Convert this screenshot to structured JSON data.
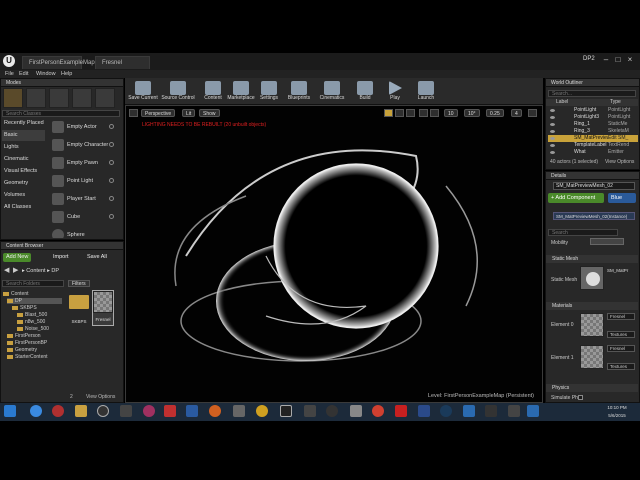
{
  "window": {
    "tabs": [
      "FirstPersonExampleMap",
      "Fresnel"
    ],
    "project": "DP2"
  },
  "menu": [
    "File",
    "Edit",
    "Window",
    "Help"
  ],
  "modes": {
    "title": "Modes",
    "search_placeholder": "Search Classes",
    "categories": [
      "Recently Placed",
      "Basic",
      "Lights",
      "Cinematic",
      "Visual Effects",
      "Geometry",
      "Volumes",
      "All Classes"
    ],
    "selected_category": "Basic",
    "items": [
      "Empty Actor",
      "Empty Character",
      "Empty Pawn",
      "Point Light",
      "Player Start",
      "Cube",
      "Sphere"
    ]
  },
  "toolbar": [
    "Save Current",
    "Source Control",
    "Content",
    "Marketplace",
    "Settings",
    "Blueprints",
    "Cinematics",
    "Build",
    "Play",
    "Launch"
  ],
  "viewport": {
    "perspective": "Perspective",
    "lit": "Lit",
    "show": "Show",
    "grid": "10",
    "angle": "10°",
    "scale": "0.25",
    "cam": "4",
    "warning": "LIGHTING NEEDS TO BE REBUILT (20 unbuilt objects)",
    "level_label": "Level:",
    "level_name": "FirstPersonExampleMap (Persistent)"
  },
  "content_browser": {
    "title": "Content Browser",
    "add_new": "Add New",
    "import": "Import",
    "save_all": "Save All",
    "path": [
      "Content",
      "DP"
    ],
    "search_placeholder": "Search Folders",
    "filters": "Filters",
    "tree": [
      "Content",
      "DP",
      "SKBPS",
      "Blast_500",
      "n8w_500",
      "Noise_500",
      "FirstPerson",
      "FirstPersonBP",
      "Geometry",
      "StarterContent"
    ],
    "assets": [
      "SKBPS",
      "Fresnel"
    ],
    "item_count": "2",
    "view_options": "View Options"
  },
  "outliner": {
    "title": "World Outliner",
    "search_placeholder": "Search...",
    "col_label": "Label",
    "col_type": "Type",
    "rows": [
      {
        "label": "PointLight",
        "type": "PointLight"
      },
      {
        "label": "PointLight3",
        "type": "PointLight"
      },
      {
        "label": "Ring_1",
        "type": "StaticMe"
      },
      {
        "label": "Ring_3",
        "type": "SkeletaM"
      },
      {
        "label": "SM_MatPreviewMesh_02",
        "type": "Edit SM_"
      },
      {
        "label": "TemplateLabel",
        "type": "TextRend"
      },
      {
        "label": "What",
        "type": "Emitter"
      }
    ],
    "selected_index": 4,
    "count": "40 actors (1 selected)",
    "view_options": "View Options"
  },
  "details": {
    "title": "Details",
    "name_value": "SM_MatPreviewMesh_02",
    "add_component": "+ Add Component",
    "blueprint": "Blue",
    "instance": "SM_MatPreviewMesh_02(Instance)",
    "search_placeholder": "Search",
    "mobility_label": "Mobility",
    "static_mesh_section": "Static Mesh",
    "static_mesh_label": "Static Mesh",
    "static_mesh_value": "SM_MatPr",
    "materials_section": "Materials",
    "element0": "Element 0",
    "element1": "Element 1",
    "element_value0": "Fresnel",
    "element_value1": "Fresnel",
    "textures": "Textures",
    "physics_section": "Physics",
    "simulate": "Simulate Ph"
  },
  "taskbar": {
    "time": "10:10 PM",
    "date": "5/6/2015"
  }
}
